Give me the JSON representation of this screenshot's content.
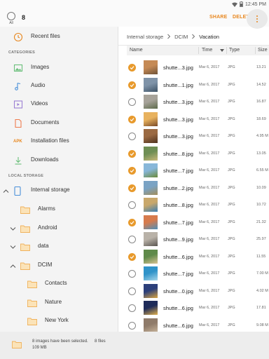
{
  "status_bar": {
    "time": "12:45 PM"
  },
  "top_bar": {
    "all_label": "All",
    "selected_count": "8",
    "share_label": "SHARE",
    "delete_label": "DELETE"
  },
  "colors": {
    "accent": "#e8871e",
    "check": "#e89a2c",
    "folder": "#f6c47a"
  },
  "sidebar": {
    "recent": {
      "label": "Recent files",
      "icon": "clock-icon"
    },
    "categories_header": "CATEGORIES",
    "categories": [
      {
        "label": "Images",
        "icon": "image-icon"
      },
      {
        "label": "Audio",
        "icon": "music-note-icon"
      },
      {
        "label": "Videos",
        "icon": "video-icon"
      },
      {
        "label": "Documents",
        "icon": "document-icon"
      },
      {
        "label": "Installation files",
        "icon": "apk-icon",
        "icon_text": "APK"
      },
      {
        "label": "Downloads",
        "icon": "download-icon"
      }
    ],
    "local_storage_header": "LOCAL STORAGE",
    "tree": [
      {
        "label": "Internal storage",
        "icon": "phone-icon",
        "expanded": true
      },
      {
        "label": "Alarms",
        "icon": "folder-icon"
      },
      {
        "label": "Android",
        "icon": "folder-icon",
        "collapsed": true
      },
      {
        "label": "data",
        "icon": "folder-icon",
        "collapsed": true
      },
      {
        "label": "DCIM",
        "icon": "folder-icon",
        "expanded": true
      },
      {
        "label": "Contacts",
        "icon": "folder-icon"
      },
      {
        "label": "Nature",
        "icon": "folder-icon"
      },
      {
        "label": "New York",
        "icon": "folder-icon"
      }
    ]
  },
  "breadcrumb": [
    "Internal storage",
    "DCIM",
    "Vacation"
  ],
  "columns": {
    "name": "Name",
    "time": "Time",
    "type": "Type",
    "size": "Size"
  },
  "files": [
    {
      "name": "shutte...3.jpg",
      "date": "Mar 6, 2017",
      "type": "JPG",
      "size": "13.21",
      "checked": true,
      "thumb": [
        "#c58a55",
        "#6f5338"
      ]
    },
    {
      "name": "shutte...1.jpg",
      "date": "Mar 6, 2017",
      "type": "JPG",
      "size": "14.52",
      "checked": true,
      "thumb": [
        "#7f93a8",
        "#3e5366"
      ]
    },
    {
      "name": "shutte...3.jpg",
      "date": "Mar 6, 2017",
      "type": "JPG",
      "size": "16.87",
      "checked": false,
      "thumb": [
        "#a7a39a",
        "#5d6b4a"
      ]
    },
    {
      "name": "shutte...3.jpg",
      "date": "Mar 6, 2017",
      "type": "JPG",
      "size": "18.69",
      "checked": true,
      "thumb": [
        "#e8b25e",
        "#7a4a28"
      ]
    },
    {
      "name": "shutte...3.jpg",
      "date": "Mar 6, 2017",
      "type": "JPG",
      "size": "4.95 M",
      "checked": false,
      "thumb": [
        "#9b6a43",
        "#4e3320"
      ]
    },
    {
      "name": "shutte...8.jpg",
      "date": "Mar 6, 2017",
      "type": "JPG",
      "size": "13.05",
      "checked": true,
      "thumb": [
        "#6e8e54",
        "#c9b97a"
      ]
    },
    {
      "name": "shutte...7.jpg",
      "date": "Mar 6, 2017",
      "type": "JPG",
      "size": "6.55 M",
      "checked": true,
      "thumb": [
        "#88b7d9",
        "#6a8a3a"
      ]
    },
    {
      "name": "shutte...2.jpg",
      "date": "Mar 6, 2017",
      "type": "JPG",
      "size": "10.09",
      "checked": true,
      "thumb": [
        "#7aa3c4",
        "#a28d5a"
      ]
    },
    {
      "name": "shutte...8.jpg",
      "date": "Mar 6, 2017",
      "type": "JPG",
      "size": "10.72",
      "checked": false,
      "thumb": [
        "#c9a86b",
        "#3c7fb3"
      ]
    },
    {
      "name": "shutte...7.jpg",
      "date": "Mar 6, 2017",
      "type": "JPG",
      "size": "21.32",
      "checked": true,
      "thumb": [
        "#d67b4d",
        "#4f8fb8"
      ]
    },
    {
      "name": "shutte...9.jpg",
      "date": "Mar 6, 2017",
      "type": "JPG",
      "size": "25.97",
      "checked": false,
      "thumb": [
        "#b9b2a8",
        "#5a5550"
      ]
    },
    {
      "name": "shutte...6.jpg",
      "date": "Mar 6, 2017",
      "type": "JPG",
      "size": "11.55",
      "checked": true,
      "thumb": [
        "#5f8a4a",
        "#d7c394"
      ]
    },
    {
      "name": "shutte...7.jpg",
      "date": "Mar 6, 2017",
      "type": "JPG",
      "size": "7.00 M",
      "checked": false,
      "thumb": [
        "#2f93c9",
        "#a6d6ea"
      ]
    },
    {
      "name": "shutte...0.jpg",
      "date": "Mar 6, 2017",
      "type": "JPG",
      "size": "4.02 M",
      "checked": false,
      "thumb": [
        "#2c3f7a",
        "#d9a441"
      ]
    },
    {
      "name": "shutte...6.jpg",
      "date": "Mar 6, 2017",
      "type": "JPG",
      "size": "17.81",
      "checked": false,
      "thumb": [
        "#1e2b59",
        "#e0b04d"
      ]
    },
    {
      "name": "shutte...6.jpg",
      "date": "Mar 6, 2017",
      "type": "JPG",
      "size": "9.08 M",
      "checked": false,
      "thumb": [
        "#8f7b6a",
        "#c7b39a"
      ]
    }
  ],
  "bottom_bar": {
    "selection_text": "8 images have been selected.",
    "file_count": "8 files",
    "total_size": "109 MB"
  }
}
